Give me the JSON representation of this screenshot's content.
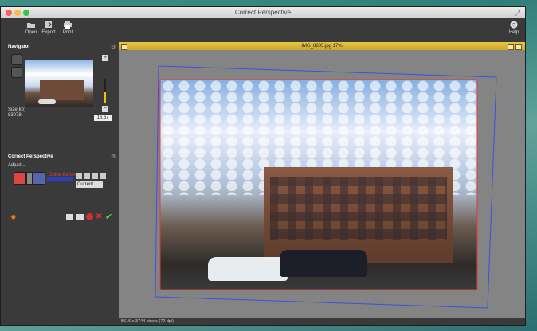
{
  "window": {
    "title": "Correct Perspective"
  },
  "toolbar": {
    "open": "Open",
    "export": "Export",
    "print": "Print",
    "help": "Help"
  },
  "navigator": {
    "title": "Navigator",
    "zoom": "16.67",
    "size_label": "Size(kb)",
    "size_value": "83078"
  },
  "correct_perspective": {
    "title": "Correct Perspective",
    "adjust_label": "Adjust...",
    "guide_before": "Guide Before",
    "current_select": "Current"
  },
  "document": {
    "title": "IMG_8805.jpg 17%",
    "status": "5616 x 3744 pixels (72 dpi)"
  },
  "colors": {
    "accent_yellow": "#f3c010",
    "guide_red": "#e23b3b",
    "guide_blue": "#3b4fe2"
  }
}
